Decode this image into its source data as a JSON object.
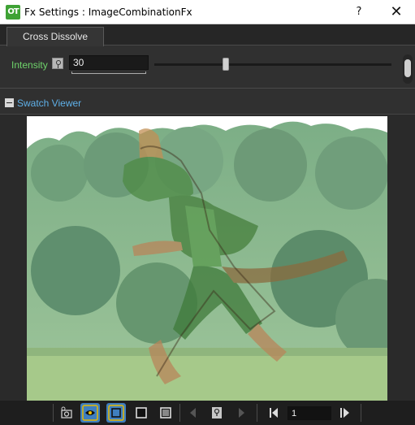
{
  "window": {
    "app_icon_text": "OT",
    "title": "Fx Settings : ImageCombinationFx",
    "help_label": "?",
    "close_label": "✕"
  },
  "tabs": [
    {
      "label": "Cross Dissolve",
      "active": true
    }
  ],
  "intensity": {
    "label": "Intensity",
    "value": "30",
    "slider_fraction": 0.3
  },
  "swatch_viewer": {
    "collapse_symbol": "−",
    "label": "Swatch Viewer"
  },
  "toolbar": {
    "icons": [
      "camera-settings-icon",
      "eye-icon",
      "transparency-check-icon",
      "black-background-icon",
      "white-background-icon",
      "previous-icon",
      "lock-icon",
      "next-icon",
      "first-frame-icon",
      "last-frame-icon"
    ],
    "frame_value": "1"
  },
  "colors": {
    "label_green": "#6fd46b",
    "link_blue": "#5fb0e8",
    "toggle_blue": "#3f7fbf",
    "panel_bg": "#303030"
  }
}
